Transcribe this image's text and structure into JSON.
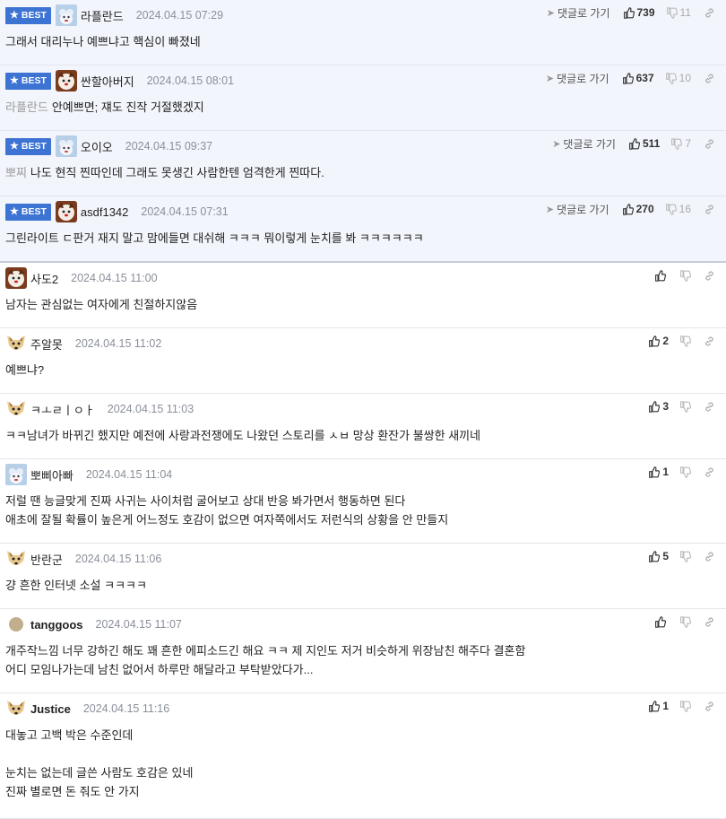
{
  "best_label": "BEST",
  "reply_label": "댓글로 가기",
  "best_comments": [
    {
      "nick": "라플란드",
      "date": "2024.04.15 07:29",
      "likes": "739",
      "dislikes": "11",
      "mention": "",
      "lines": [
        "그래서 대리누나 예쁘냐고 핵심이 빠졌네"
      ],
      "avatar": "blue"
    },
    {
      "nick": "싼할아버지",
      "date": "2024.04.15 08:01",
      "likes": "637",
      "dislikes": "10",
      "mention": "라플란드",
      "lines": [
        "안예쁘면; 쟤도 진작 거절했겠지"
      ],
      "avatar": "dog"
    },
    {
      "nick": "오이오",
      "date": "2024.04.15 09:37",
      "likes": "511",
      "dislikes": "7",
      "mention": "뽀찌",
      "lines": [
        "나도 현직 찐따인데 그래도 못생긴 사람한텐 엄격한게 찐따다."
      ],
      "avatar": "blue"
    },
    {
      "nick": "asdf1342",
      "date": "2024.04.15 07:31",
      "likes": "270",
      "dislikes": "16",
      "mention": "",
      "lines": [
        "그린라이트 ㄷ판거 재지 말고 맘에들면 대쉬해 ㅋㅋㅋ 뭐이렇게 눈치를 봐 ㅋㅋㅋㅋㅋㅋ"
      ],
      "avatar": "dog"
    }
  ],
  "comments": [
    {
      "nick": "사도2",
      "date": "2024.04.15 11:00",
      "likes": "",
      "bold": false,
      "avatar": "dog",
      "lines": [
        "남자는 관심없는 여자에게 친절하지않음"
      ],
      "height": 73
    },
    {
      "nick": "주알못",
      "date": "2024.04.15 11:02",
      "likes": "2",
      "bold": false,
      "avatar": "fox",
      "lines": [
        "예쁘냐?"
      ],
      "height": 73
    },
    {
      "nick": "ㅋㅗㄹㅣㅇㅏ",
      "date": "2024.04.15 11:03",
      "likes": "3",
      "bold": false,
      "avatar": "fox",
      "lines": [
        "ㅋㅋ남녀가 바뀌긴 했지만 예전에 사랑과전쟁에도 나왔던 스토리를 ㅅㅂ 망상 환잔가 불쌍한 새끼네"
      ],
      "height": 73
    },
    {
      "nick": "뽀삐아빠",
      "date": "2024.04.15 11:04",
      "likes": "1",
      "bold": false,
      "avatar": "blue",
      "lines": [
        "저럴 땐 능글맞게 진짜 사귀는 사이처럼 굴어보고 상대 반응 봐가면서 행동하면 된다",
        "애초에 잘될 확률이 높은게 어느정도 호감이 없으면 여자쪽에서도 저런식의 상황을 안 만들지"
      ],
      "height": 94
    },
    {
      "nick": "반란군",
      "date": "2024.04.15 11:06",
      "likes": "5",
      "bold": false,
      "avatar": "fox",
      "lines": [
        "걍 흔한 인터넷 소설 ㅋㅋㅋㅋ"
      ],
      "height": 73
    },
    {
      "nick": "tanggoos",
      "date": "2024.04.15 11:07",
      "likes": "",
      "bold": true,
      "avatar": "circle",
      "lines": [
        "개주작느낌 너무 강하긴 해도 꽤 흔한 에피소드긴 해요 ㅋㅋ 제 지인도 저거 비슷하게 위장남친 해주다 결혼함",
        "어디 모임나가는데 남친 없어서 하루만 해달라고 부탁받았다가..."
      ],
      "height": 94
    },
    {
      "nick": "Justice",
      "date": "2024.04.15 11:16",
      "likes": "1",
      "bold": true,
      "avatar": "fox",
      "lines": [
        "대놓고 고백 박은 수준인데",
        "",
        "눈치는 없는데 글쓴 사람도 호감은 있네",
        "진짜 별로면 돈 줘도 안 가지"
      ],
      "height": 140
    }
  ]
}
